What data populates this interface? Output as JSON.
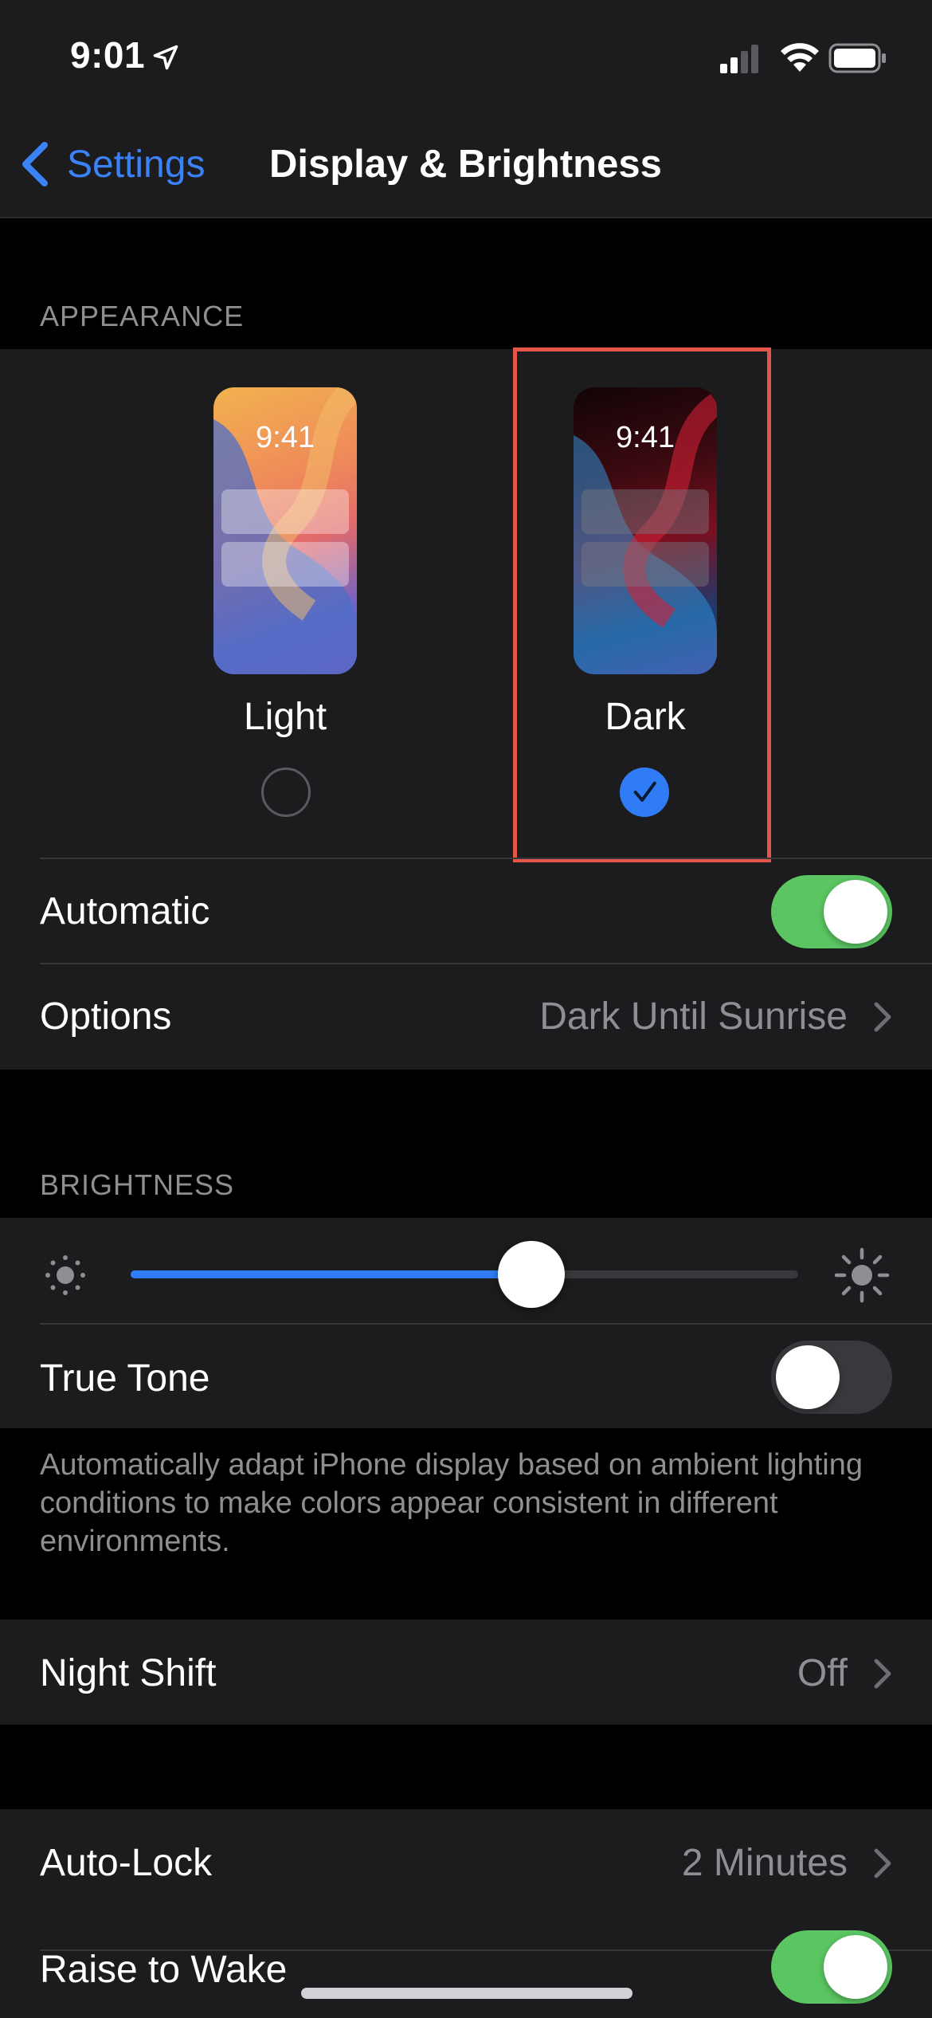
{
  "status_bar": {
    "time": "9:01",
    "location_icon": "location-arrow-icon",
    "signal_icon": "cellular-signal-icon",
    "wifi_icon": "wifi-icon",
    "battery_icon": "battery-icon"
  },
  "nav": {
    "back_label": "Settings",
    "title": "Display & Brightness"
  },
  "appearance": {
    "header": "APPEARANCE",
    "options": [
      {
        "label": "Light",
        "preview_time": "9:41",
        "selected": false
      },
      {
        "label": "Dark",
        "preview_time": "9:41",
        "selected": true
      }
    ],
    "automatic": {
      "label": "Automatic",
      "on": true
    },
    "options_row": {
      "label": "Options",
      "value": "Dark Until Sunrise"
    }
  },
  "brightness": {
    "header": "BRIGHTNESS",
    "level": 0.6,
    "true_tone": {
      "label": "True Tone",
      "on": false
    },
    "footnote": "Automatically adapt iPhone display based on ambient lighting conditions to make colors appear consistent in different environments."
  },
  "night_shift": {
    "label": "Night Shift",
    "value": "Off"
  },
  "auto_lock": {
    "label": "Auto-Lock",
    "value": "2 Minutes"
  },
  "raise_to_wake": {
    "label": "Raise to Wake",
    "on": true
  },
  "colors": {
    "accent": "#2f7cf6",
    "toggle_on": "#5ac561",
    "highlight": "#e5554a",
    "background": "#000000",
    "group": "#1c1c1e"
  }
}
